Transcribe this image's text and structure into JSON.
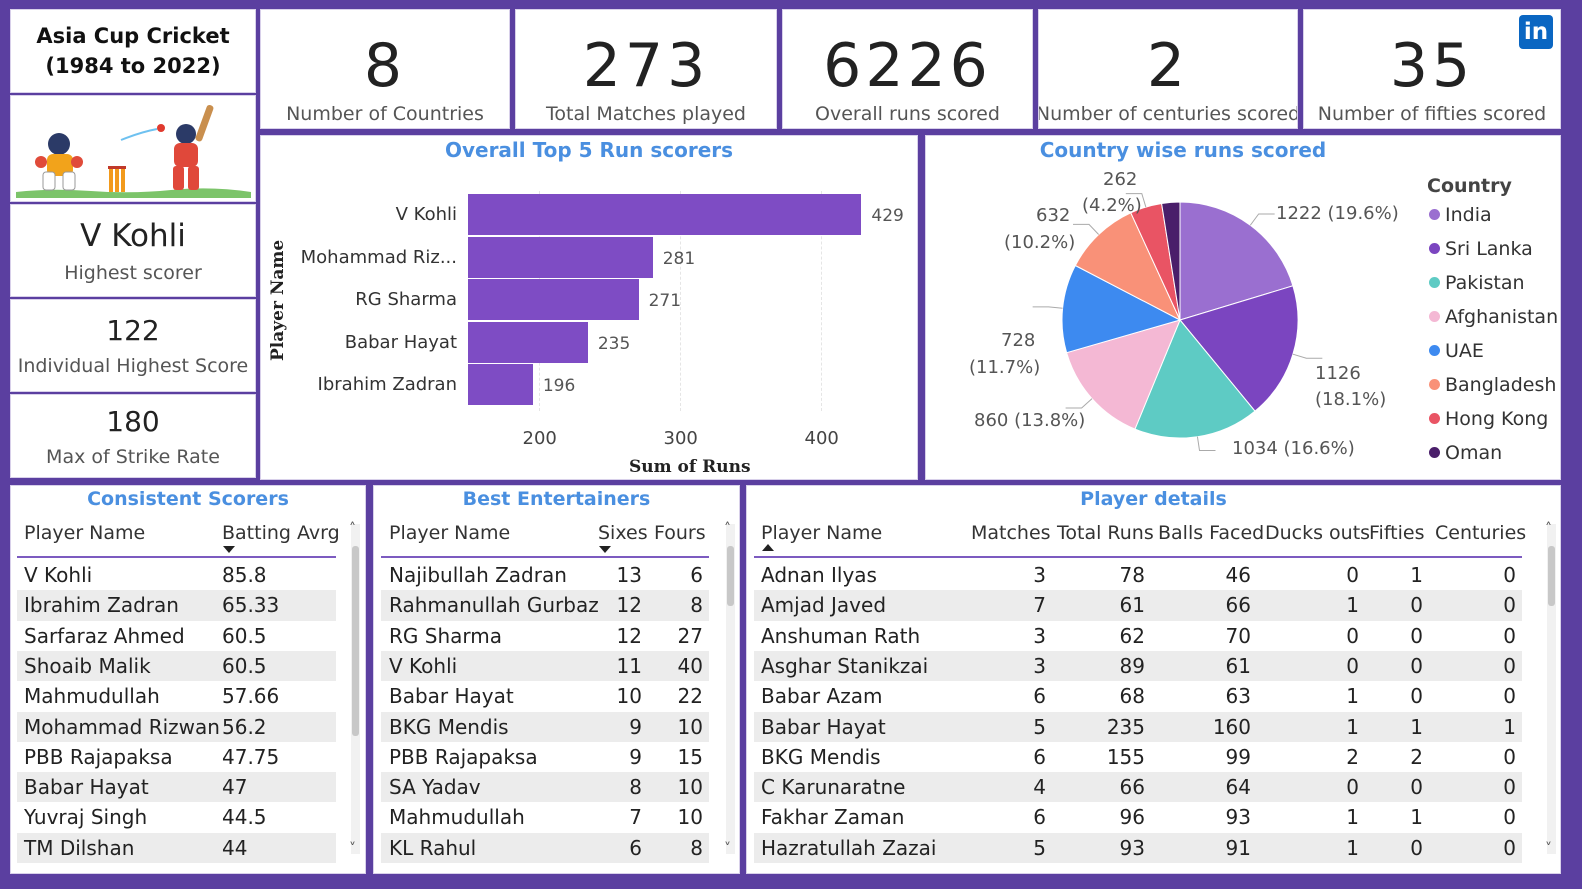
{
  "dashboard": {
    "title_line1": "Asia Cup Cricket",
    "title_line2": "(1984 to 2022)",
    "illustration_icon": "cricket-batsman-wicketkeeper-illustration",
    "linkedin_icon": "in",
    "accent_color": "#7e4cc4",
    "title_color": "#4a8fe0"
  },
  "kpis": [
    {
      "value": "8",
      "label": "Number of Countries"
    },
    {
      "value": "273",
      "label": "Total Matches played"
    },
    {
      "value": "6226",
      "label": "Overall runs scored"
    },
    {
      "value": "2",
      "label": "Number of centuries scored"
    },
    {
      "value": "35",
      "label": "Number of fifties scored"
    }
  ],
  "side": {
    "highest_scorer": {
      "value": "V Kohli",
      "label": "Highest scorer"
    },
    "individual_highest": {
      "value": "122",
      "label": "Individual Highest Score"
    },
    "max_strike_rate": {
      "value": "180",
      "label": "Max of Strike Rate"
    }
  },
  "bar_chart": {
    "title": "Overall Top 5 Run scorers",
    "ylabel": "Player Name",
    "xlabel": "Sum of Runs",
    "ticks": [
      "200",
      "300",
      "400"
    ]
  },
  "chart_data": [
    {
      "type": "bar",
      "orientation": "horizontal",
      "title": "Overall Top 5 Run scorers",
      "xlabel": "Sum of Runs",
      "ylabel": "Player Name",
      "categories": [
        "V Kohli",
        "Mohammad Riz...",
        "RG Sharma",
        "Babar Hayat",
        "Ibrahim Zadran"
      ],
      "values": [
        429,
        281,
        271,
        235,
        196
      ],
      "xlim": [
        150,
        450
      ],
      "grid": true,
      "color": "#7e4cc4"
    },
    {
      "type": "pie",
      "title": "Country wise runs scored",
      "legend_title": "Country",
      "legend_position": "right",
      "labels": [
        "India",
        "Sri Lanka",
        "Pakistan",
        "Afghanistan",
        "UAE",
        "Bangladesh",
        "Hong Kong",
        "Oman"
      ],
      "values": [
        1222,
        1126,
        1034,
        860,
        728,
        632,
        262,
        150
      ],
      "data_labels": [
        "1222 (19.6%)",
        "1126 (18.1%)",
        "1034 (16.6%)",
        "860 (13.8%)",
        "728 (11.7%)",
        "632 (10.2%)",
        "262 (4.2%)",
        ""
      ],
      "colors": [
        "#9a6fd0",
        "#7b45c0",
        "#5ecbc4",
        "#f4b8d4",
        "#3d8af0",
        "#f99178",
        "#e95464",
        "#4a1e6a"
      ]
    }
  ],
  "pie_chart": {
    "title": "Country wise runs scored",
    "legend_title": "Country",
    "legend": [
      "India",
      "Sri Lanka",
      "Pakistan",
      "Afghanistan",
      "UAE",
      "Bangladesh",
      "Hong Kong",
      "Oman"
    ],
    "lbl_india": "1222 (19.6%)",
    "lbl_srilanka_1": "1126",
    "lbl_srilanka_2": "(18.1%)",
    "lbl_pakistan": "1034 (16.6%)",
    "lbl_afghanistan": "860 (13.8%)",
    "lbl_uae_1": "728",
    "lbl_uae_2": "(11.7%)",
    "lbl_bangladesh_1": "632",
    "lbl_bangladesh_2": "(10.2%)",
    "lbl_hongkong_1": "262",
    "lbl_hongkong_2": "(4.2%)"
  },
  "consistent": {
    "title": "Consistent Scorers",
    "headers": [
      "Player Name",
      "Batting Avrg"
    ],
    "rows": [
      [
        "V Kohli",
        "85.8"
      ],
      [
        "Ibrahim Zadran",
        "65.33"
      ],
      [
        "Sarfaraz Ahmed",
        "60.5"
      ],
      [
        "Shoaib Malik",
        "60.5"
      ],
      [
        "Mahmudullah",
        "57.66"
      ],
      [
        "Mohammad Rizwan",
        "56.2"
      ],
      [
        "PBB Rajapaksa",
        "47.75"
      ],
      [
        "Babar Hayat",
        "47"
      ],
      [
        "Yuvraj Singh",
        "44.5"
      ],
      [
        "TM Dilshan",
        "44"
      ]
    ]
  },
  "entertainers": {
    "title": "Best Entertainers",
    "headers": [
      "Player Name",
      "Sixes",
      "Fours"
    ],
    "rows": [
      [
        "Najibullah Zadran",
        "13",
        "6"
      ],
      [
        "Rahmanullah Gurbaz",
        "12",
        "8"
      ],
      [
        "RG Sharma",
        "12",
        "27"
      ],
      [
        "V Kohli",
        "11",
        "40"
      ],
      [
        "Babar Hayat",
        "10",
        "22"
      ],
      [
        "BKG Mendis",
        "9",
        "10"
      ],
      [
        "PBB Rajapaksa",
        "9",
        "15"
      ],
      [
        "SA Yadav",
        "8",
        "10"
      ],
      [
        "Mahmudullah",
        "7",
        "10"
      ],
      [
        "KL Rahul",
        "6",
        "8"
      ]
    ]
  },
  "details": {
    "title": "Player details",
    "headers": [
      "Player Name",
      "Matches",
      "Total Runs",
      "Balls Faced",
      "Ducks outs",
      "Fifties",
      "Centuries"
    ],
    "rows": [
      [
        "Adnan Ilyas",
        "3",
        "78",
        "46",
        "0",
        "1",
        "0"
      ],
      [
        "Amjad Javed",
        "7",
        "61",
        "66",
        "1",
        "0",
        "0"
      ],
      [
        "Anshuman Rath",
        "3",
        "62",
        "70",
        "0",
        "0",
        "0"
      ],
      [
        "Asghar Stanikzai",
        "3",
        "89",
        "61",
        "0",
        "0",
        "0"
      ],
      [
        "Babar Azam",
        "6",
        "68",
        "63",
        "1",
        "0",
        "0"
      ],
      [
        "Babar Hayat",
        "5",
        "235",
        "160",
        "1",
        "1",
        "1"
      ],
      [
        "BKG Mendis",
        "6",
        "155",
        "99",
        "2",
        "2",
        "0"
      ],
      [
        "C Karunaratne",
        "4",
        "66",
        "64",
        "0",
        "0",
        "0"
      ],
      [
        "Fakhar Zaman",
        "6",
        "96",
        "93",
        "1",
        "1",
        "0"
      ],
      [
        "Hazratullah Zazai",
        "5",
        "93",
        "91",
        "1",
        "0",
        "0"
      ]
    ]
  }
}
